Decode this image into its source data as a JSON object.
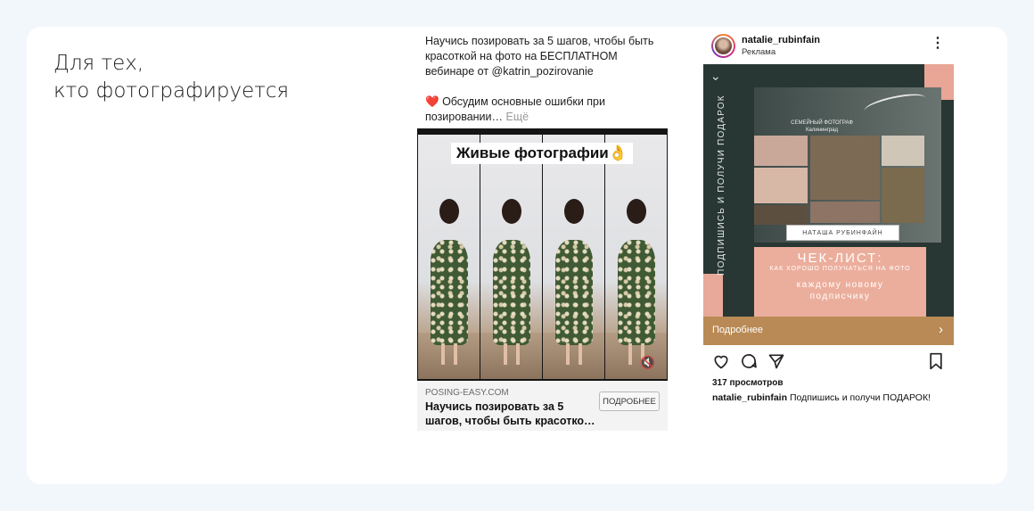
{
  "heading": {
    "line1": "Для тех,",
    "line2": "кто фотографируется"
  },
  "fb_ad": {
    "text_line1": "Научись позировать за 5 шагов, чтобы быть",
    "text_line2": "красоткой на фото на БЕСПЛАТНОМ",
    "text_line3": "вебинаре от @katrin_pozirovanie",
    "text_line4": "Обсудим основные ошибки при",
    "text_line5": "позировании…",
    "more": "Ещё",
    "overlay": "Живые фотографии👌",
    "domain": "POSING-EASY.COM",
    "headline_line1": "Научись позировать за 5",
    "headline_line2": "шагов, чтобы быть красотко…",
    "button": "ПОДРОБНЕЕ"
  },
  "ig_ad": {
    "username": "natalie_rubinfain",
    "sponsored": "Реклама",
    "side_text": "ПОДПИШИСЬ И ПОЛУЧИ ПОДАРОК",
    "photographer_line1": "СЕМЕЙНЫЙ ФОТОГРАФ",
    "photographer_line2": "Калининград",
    "name_plate": "НАТАША РУБИНФАЙН",
    "checklist_title": "ЧЕК-ЛИСТ:",
    "checklist_sub": "КАК ХОРОШО ПОЛУЧАТЬСЯ НА ФОТО",
    "gift_line1": "каждому новому",
    "gift_line2": "подписчику",
    "cta": "Подробнее",
    "views": "317 просмотров",
    "caption_user": "natalie_rubinfain",
    "caption_text": "Подпишись и получи ПОДАРОК!"
  },
  "colors": {
    "page_bg": "#f2f7fc",
    "card_bg": "#ffffff",
    "ig_cta": "#b98a55",
    "ig_pink": "#ecae9c",
    "ig_dark": "#283734"
  }
}
